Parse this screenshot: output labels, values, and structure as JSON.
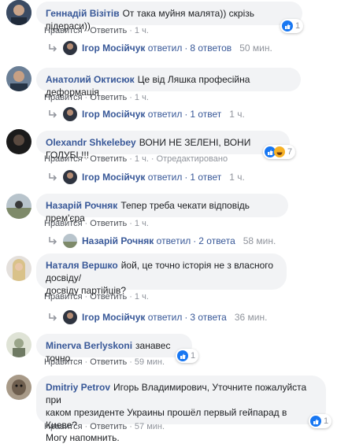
{
  "comments": [
    {
      "name": "Геннадій Візітів",
      "text": "От така муйня малята)) скрізь підераси))",
      "like": "Нравится",
      "reply": "Ответить",
      "time": "1 ч.",
      "reactions": "1",
      "replies": {
        "name": "Ігор Мосійчук",
        "verb": "ответил",
        "count": "8 ответов",
        "time": "50 мин."
      }
    },
    {
      "name": "Анатолий Октисюк",
      "text": "Це від Ляшка професійна деформація",
      "like": "Нравится",
      "reply": "Ответить",
      "time": "1 ч.",
      "replies": {
        "name": "Ігор Мосійчук",
        "verb": "ответил",
        "count": "1 ответ",
        "time": "1 ч."
      }
    },
    {
      "name": "Olexandr Shkelebey",
      "text": "ВОНИ НЕ ЗЕЛЕНІ, ВОНИ ГОЛУБІ !!!",
      "like": "Нравится",
      "reply": "Ответить",
      "time": "1 ч.",
      "edited": "Отредактировано",
      "reactions": "7",
      "replies": {
        "name": "Ігор Мосійчук",
        "verb": "ответил",
        "count": "1 ответ",
        "time": "1 ч."
      }
    },
    {
      "name": "Назарій Рочняк",
      "text": "Тепер треба чекати відповідь прем'єра",
      "like": "Нравится",
      "reply": "Ответить",
      "time": "1 ч.",
      "replies": {
        "name": "Назарій Рочняк",
        "verb": "ответил",
        "count": "2 ответа",
        "time": "58 мин."
      }
    },
    {
      "name": "Наталя Вершко",
      "text_line1": "йой, це точно історія не з власного досвіду/",
      "text_line2": "досвіду партійців?",
      "like": "Нравится",
      "reply": "Ответить",
      "time": "1 ч.",
      "replies": {
        "name": "Ігор Мосійчук",
        "verb": "ответил",
        "count": "3 ответа",
        "time": "36 мин."
      }
    },
    {
      "name": "Minerva Berlyskoni",
      "text": "занавес точно",
      "like": "Нравится",
      "reply": "Ответить",
      "time": "59 мин.",
      "reactions": "1"
    },
    {
      "name": "Dmitriy Petrov",
      "text_line1": "Игорь Владимирович, Уточните пожалуйста при",
      "text_line2": "каком президенте Украины прошёл первый гейпарад в Киеве?",
      "text_line3": "Могу напомнить.",
      "like": "Нравится",
      "reply": "Ответить",
      "time": "57 мин.",
      "reactions": "1"
    }
  ],
  "colors": {
    "link": "#385898",
    "meta": "#90949c",
    "bubble": "#f2f3f5",
    "like_blue": "#1877f2"
  }
}
